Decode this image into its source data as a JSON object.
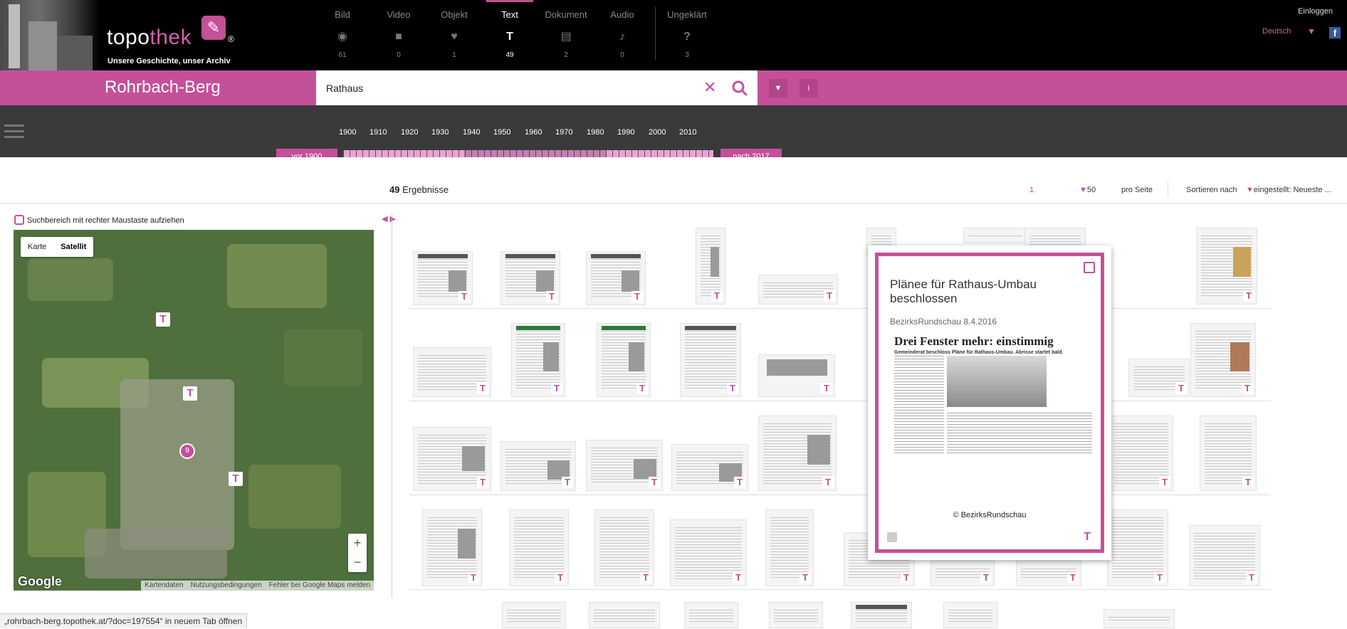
{
  "header": {
    "brand_part1": "topo",
    "brand_part2": "thek",
    "brand_reg": "®",
    "tagline": "Unsere Geschichte, unser Archiv",
    "login_label": "Einloggen",
    "language_label": "Deutsch"
  },
  "categories": [
    {
      "label": "Bild",
      "count": "61",
      "icon": "image-icon"
    },
    {
      "label": "Video",
      "count": "0",
      "icon": "video-icon"
    },
    {
      "label": "Objekt",
      "count": "1",
      "icon": "object-icon"
    },
    {
      "label": "Text",
      "count": "49",
      "icon": "text-icon"
    },
    {
      "label": "Dokument",
      "count": "2",
      "icon": "document-icon"
    },
    {
      "label": "Audio",
      "count": "0",
      "icon": "audio-icon"
    },
    {
      "label": "Ungeklärt",
      "count": "3",
      "icon": "question-icon"
    }
  ],
  "searchbar": {
    "place_name": "Rohrbach-Berg",
    "query": "Rathaus",
    "info_label": "i"
  },
  "timeline": {
    "years": [
      "1900",
      "1910",
      "1920",
      "1930",
      "1940",
      "1950",
      "1960",
      "1970",
      "1980",
      "1990",
      "2000",
      "2010"
    ],
    "before_label": "vor 1900",
    "after_label": "nach 2017"
  },
  "results": {
    "count": "49",
    "count_label": "Ergebnisse",
    "page": "1",
    "per_page": "50",
    "per_page_label": "pro Seite",
    "sort_label": "Sortieren nach",
    "sort_value": "eingestellt: Neueste ..."
  },
  "map": {
    "hint": "Suchbereich mit rechter Maustaste aufziehen",
    "type_map": "Karte",
    "type_satellite": "Satellit",
    "cluster_count": "9",
    "zoom_in": "+",
    "zoom_out": "−",
    "google": "Google",
    "footer_items": [
      "Kartendaten",
      "Nutzungsbedingungen",
      "Fehler bei Google Maps melden"
    ]
  },
  "popup": {
    "title": "Plänee für Rathaus-Umbau beschlossen",
    "source": "BezirksRundschau 8.4.2016",
    "headline": "Drei Fenster mehr: einstimmig",
    "subhead": "Gemeinderat beschloss Pläne für Rathaus-Umbau. Abrisse startet bald.",
    "copyright": "© BezirksRundschau",
    "tag": "T"
  },
  "status_url": "„rohrbach-berg.topothek.at/?doc=197554“ in neuem Tab öffnen",
  "colors": {
    "accent": "#c4509a",
    "header_bg": "#000000",
    "timeline_bg": "#3a3a3a"
  }
}
